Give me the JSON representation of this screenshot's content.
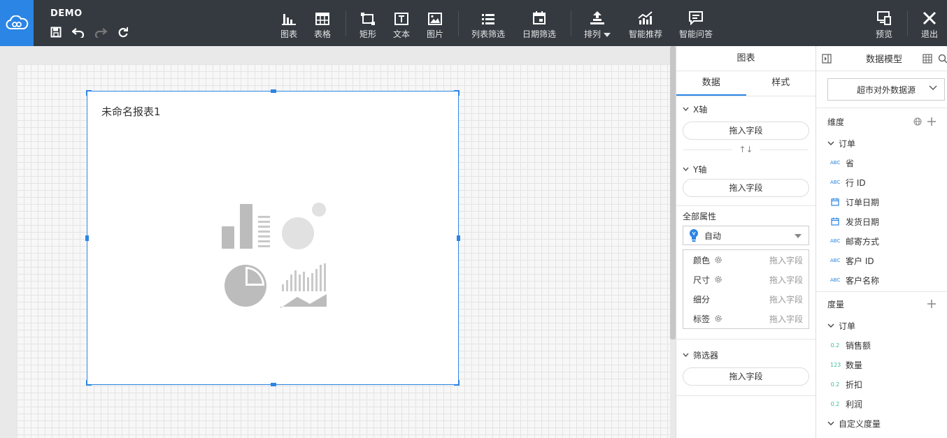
{
  "app": {
    "name": "DEMO"
  },
  "toolbar": {
    "chart": "图表",
    "table": "表格",
    "rect": "矩形",
    "text": "文本",
    "image": "图片",
    "list_filter": "列表筛选",
    "date_filter": "日期筛选",
    "arrange": "排列",
    "smart_recommend": "智能推荐",
    "smart_qa": "智能问答",
    "preview": "预览",
    "exit": "退出"
  },
  "canvas": {
    "widget_title": "未命名报表1"
  },
  "config": {
    "header": "图表",
    "tabs": [
      "数据",
      "样式"
    ],
    "x_axis": "X轴",
    "y_axis": "Y轴",
    "drop_hint": "拖入字段",
    "swap": "↑↓",
    "all_props": "全部属性",
    "auto": "自动",
    "attrs": [
      {
        "name": "颜色",
        "value": "拖入字段"
      },
      {
        "name": "尺寸",
        "value": "拖入字段"
      },
      {
        "name": "细分",
        "value": "拖入字段"
      },
      {
        "name": "标签",
        "value": "拖入字段"
      }
    ],
    "filter": "筛选器"
  },
  "model": {
    "header": "数据模型",
    "datasource": "超市对外数据源",
    "dimensions_label": "维度",
    "dim_group": "订单",
    "dimensions": [
      {
        "type": "ABC",
        "name": "省"
      },
      {
        "type": "ABC",
        "name": "行 ID"
      },
      {
        "type": "date",
        "name": "订单日期"
      },
      {
        "type": "date",
        "name": "发货日期"
      },
      {
        "type": "ABC",
        "name": "邮寄方式"
      },
      {
        "type": "ABC",
        "name": "客户 ID"
      },
      {
        "type": "ABC",
        "name": "客户名称"
      }
    ],
    "measures_label": "度量",
    "measure_group": "订单",
    "measures": [
      {
        "type": "0.2",
        "name": "销售额"
      },
      {
        "type": "123",
        "name": "数量"
      },
      {
        "type": "0.2",
        "name": "折扣"
      },
      {
        "type": "0.2",
        "name": "利润"
      }
    ],
    "custom_measure": "自定义度量"
  },
  "colors": {
    "accent": "#2b85e4",
    "topbar": "#343a40",
    "measure": "#3dbf9a"
  }
}
